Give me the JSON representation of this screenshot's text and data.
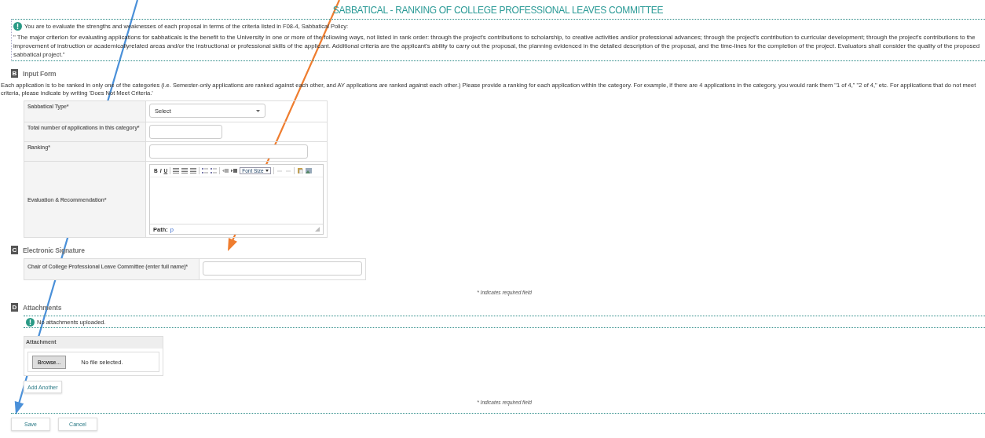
{
  "page_title": "SABBATICAL - RANKING OF COLLEGE PROFESSIONAL LEAVES COMMITTEE",
  "policy_note": {
    "intro": "You are to evaluate the strengths and weaknesses of each proposal in terms of the criteria listed in F08-4, Sabbatical Policy:",
    "quote": "\" The major criterion for evaluating applications for sabbaticals is the benefit to the University in one or more of the following ways, not listed in rank order: through the project's contributions to scholarship, to creative activities and/or professional advances; through the project's contribution to curricular development; through the project's contributions to the improvement of instruction or academicallyrelated areas and/or the instructional or professional skills of the applicant. Additional criteria are the applicant's ability to carry out the proposal, the planning evidenced in the detailed description of the proposal, and the time-lines for the completion of the project. Evaluators shall consider the quality of the proposed sabbatical project.\""
  },
  "sections": [
    {
      "letter": "B",
      "title": "Input Form",
      "kind": "form",
      "description": "Each application is to be ranked in only one of the categories (i.e. Semester-only applications are ranked against each other, and AY applications are ranked against each other.) Please provide a ranking for each application within the category. For example, if there are 4 applications in the category, you would rank them \"1 of 4,\" \"2 of 4,\" etc. For applications that do not meet criteria, please indicate by writing 'Does Not Meet Criteria.'",
      "fields": [
        {
          "label": "Sabbatical Type*",
          "kind": "select",
          "value": "Select"
        },
        {
          "label": "Total number of applications in this category*",
          "kind": "text"
        },
        {
          "label": "Ranking*",
          "kind": "text"
        },
        {
          "label": "Evaluation & Recommendation*",
          "kind": "editor",
          "bold": "B",
          "italic": "I",
          "underline": "U",
          "font_size": "Font Size",
          "path_label": "Path:",
          "path_value": "p"
        }
      ]
    },
    {
      "letter": "C",
      "title": "Electronic Signature",
      "kind": "form",
      "fields": [
        {
          "label": "Chair of College Professional Leave Committee (enter full name)*",
          "kind": "text"
        }
      ],
      "required_note": "* Indicates required field"
    },
    {
      "letter": "D",
      "title": "Attachments",
      "kind": "attachments",
      "notice": "No attachments uploaded.",
      "panel_title": "Attachment",
      "browse": "Browse...",
      "file_status": "No file selected.",
      "add_button": "Add Another",
      "required_note": "* Indicates required field"
    }
  ],
  "buttons": [
    "Save",
    "Cancel"
  ],
  "annotations": [
    {
      "color": "#4a90d9"
    },
    {
      "color": "#ef7d2f"
    }
  ]
}
